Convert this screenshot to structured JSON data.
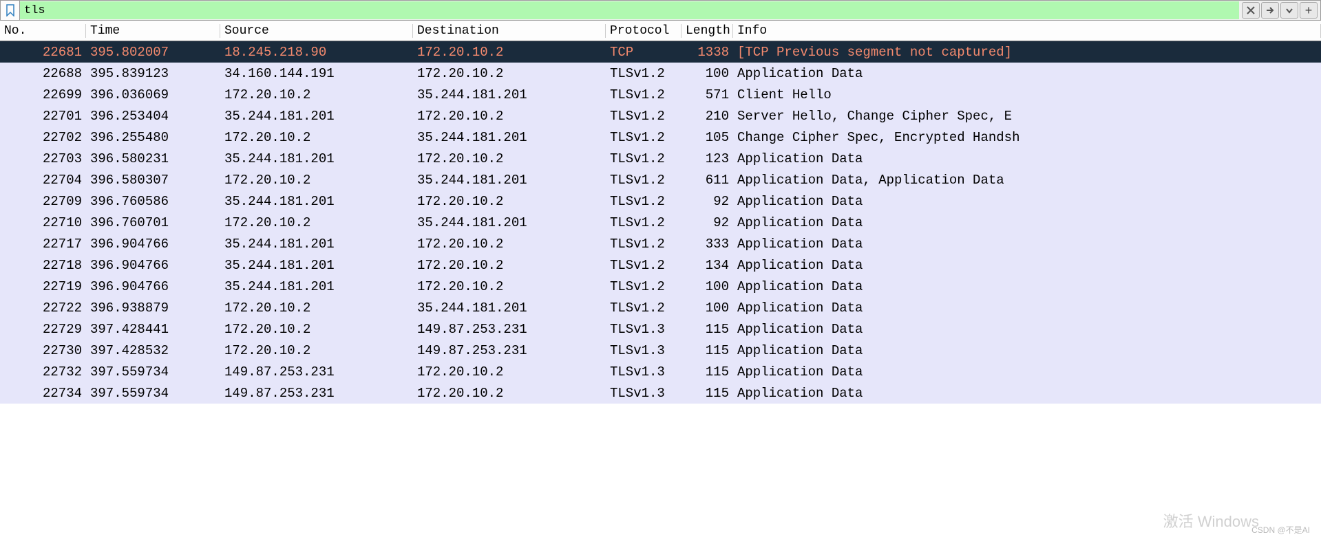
{
  "filter": {
    "value": "tls"
  },
  "columns": {
    "no": "No.",
    "time": "Time",
    "source": "Source",
    "dest": "Destination",
    "proto": "Protocol",
    "length": "Length",
    "info": "Info"
  },
  "packets": [
    {
      "no": "22681",
      "time": "395.802007",
      "src": "18.245.218.90",
      "dst": "172.20.10.2",
      "proto": "TCP",
      "len": "1338",
      "info": "[TCP Previous segment not captured]",
      "selected": true
    },
    {
      "no": "22688",
      "time": "395.839123",
      "src": "34.160.144.191",
      "dst": "172.20.10.2",
      "proto": "TLSv1.2",
      "len": "100",
      "info": "Application Data",
      "selected": false
    },
    {
      "no": "22699",
      "time": "396.036069",
      "src": "172.20.10.2",
      "dst": "35.244.181.201",
      "proto": "TLSv1.2",
      "len": "571",
      "info": "Client Hello",
      "selected": false
    },
    {
      "no": "22701",
      "time": "396.253404",
      "src": "35.244.181.201",
      "dst": "172.20.10.2",
      "proto": "TLSv1.2",
      "len": "210",
      "info": "Server Hello, Change Cipher Spec, E",
      "selected": false
    },
    {
      "no": "22702",
      "time": "396.255480",
      "src": "172.20.10.2",
      "dst": "35.244.181.201",
      "proto": "TLSv1.2",
      "len": "105",
      "info": "Change Cipher Spec, Encrypted Handsh",
      "selected": false
    },
    {
      "no": "22703",
      "time": "396.580231",
      "src": "35.244.181.201",
      "dst": "172.20.10.2",
      "proto": "TLSv1.2",
      "len": "123",
      "info": "Application Data",
      "selected": false
    },
    {
      "no": "22704",
      "time": "396.580307",
      "src": "172.20.10.2",
      "dst": "35.244.181.201",
      "proto": "TLSv1.2",
      "len": "611",
      "info": "Application Data, Application Data",
      "selected": false
    },
    {
      "no": "22709",
      "time": "396.760586",
      "src": "35.244.181.201",
      "dst": "172.20.10.2",
      "proto": "TLSv1.2",
      "len": "92",
      "info": "Application Data",
      "selected": false
    },
    {
      "no": "22710",
      "time": "396.760701",
      "src": "172.20.10.2",
      "dst": "35.244.181.201",
      "proto": "TLSv1.2",
      "len": "92",
      "info": "Application Data",
      "selected": false
    },
    {
      "no": "22717",
      "time": "396.904766",
      "src": "35.244.181.201",
      "dst": "172.20.10.2",
      "proto": "TLSv1.2",
      "len": "333",
      "info": "Application Data",
      "selected": false
    },
    {
      "no": "22718",
      "time": "396.904766",
      "src": "35.244.181.201",
      "dst": "172.20.10.2",
      "proto": "TLSv1.2",
      "len": "134",
      "info": "Application Data",
      "selected": false
    },
    {
      "no": "22719",
      "time": "396.904766",
      "src": "35.244.181.201",
      "dst": "172.20.10.2",
      "proto": "TLSv1.2",
      "len": "100",
      "info": "Application Data",
      "selected": false
    },
    {
      "no": "22722",
      "time": "396.938879",
      "src": "172.20.10.2",
      "dst": "35.244.181.201",
      "proto": "TLSv1.2",
      "len": "100",
      "info": "Application Data",
      "selected": false
    },
    {
      "no": "22729",
      "time": "397.428441",
      "src": "172.20.10.2",
      "dst": "149.87.253.231",
      "proto": "TLSv1.3",
      "len": "115",
      "info": "Application Data",
      "selected": false
    },
    {
      "no": "22730",
      "time": "397.428532",
      "src": "172.20.10.2",
      "dst": "149.87.253.231",
      "proto": "TLSv1.3",
      "len": "115",
      "info": "Application Data",
      "selected": false
    },
    {
      "no": "22732",
      "time": "397.559734",
      "src": "149.87.253.231",
      "dst": "172.20.10.2",
      "proto": "TLSv1.3",
      "len": "115",
      "info": "Application Data",
      "selected": false
    },
    {
      "no": "22734",
      "time": "397.559734",
      "src": "149.87.253.231",
      "dst": "172.20.10.2",
      "proto": "TLSv1.3",
      "len": "115",
      "info": "Application Data",
      "selected": false
    }
  ],
  "watermarks": {
    "activate": "激活 Windows",
    "csdn": "CSDN @不是AI"
  }
}
